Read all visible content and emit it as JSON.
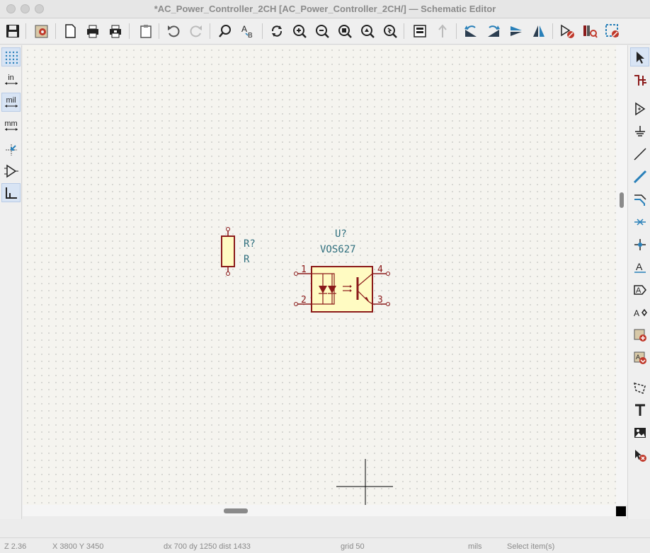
{
  "window": {
    "title": "*AC_Power_Controller_2CH [AC_Power_Controller_2CH/] — Schematic Editor"
  },
  "toolbar": {
    "icons": [
      "save-icon",
      "schematic-setup-icon",
      "page-settings-icon",
      "print-icon",
      "plot-icon",
      "paste-icon",
      "undo-icon",
      "redo-icon",
      "find-icon",
      "find-replace-icon",
      "refresh-icon",
      "zoom-in-icon",
      "zoom-out-icon",
      "zoom-fit-icon",
      "zoom-objects-icon",
      "zoom-selection-icon",
      "hierarchy-navigator-icon",
      "leave-sheet-icon",
      "rotate-ccw-icon",
      "rotate-cw-icon",
      "mirror-vertical-icon",
      "mirror-horizontal-icon",
      "symbol-editor-icon",
      "symbol-browser-icon",
      "annotate-icon"
    ]
  },
  "left_toolbar": {
    "grid_label": "",
    "inches_label": "in",
    "mils_label": "mil",
    "mm_label": "mm"
  },
  "schematic": {
    "resistor": {
      "reference": "R?",
      "value": "R"
    },
    "optocoupler": {
      "reference": "U?",
      "value": "VOS627",
      "pins": [
        "1",
        "2",
        "3",
        "4"
      ]
    },
    "colors": {
      "body_fill": "#fffbc2",
      "body_stroke": "#8b1a1a",
      "text": "#2f6f7e",
      "background": "#f5f4ef"
    }
  },
  "status": {
    "zoom": "Z 2.36",
    "xy": "X 3800  Y 3450",
    "delta": "dx 700  dy 1250  dist 1433",
    "grid": "grid 50",
    "units": "mils",
    "message": "Select item(s)"
  }
}
